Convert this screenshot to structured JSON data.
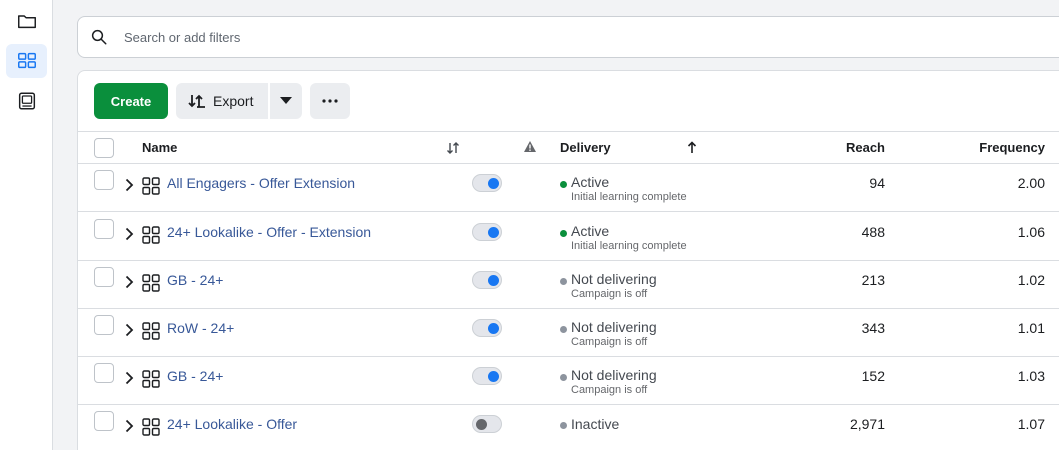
{
  "search": {
    "placeholder": "Search or add filters"
  },
  "toolbar": {
    "create_label": "Create",
    "export_label": "Export"
  },
  "columns": {
    "name": "Name",
    "delivery": "Delivery",
    "reach": "Reach",
    "frequency": "Frequency"
  },
  "colors": {
    "active": "#0a8f3c",
    "inactive": "#8d949e",
    "link": "#385898",
    "toggle_on": "#1877f2"
  },
  "rows": [
    {
      "name": "All Engagers - Offer Extension",
      "on": true,
      "status": "Active",
      "status_type": "active",
      "sub": "Initial learning complete",
      "reach": "94",
      "frequency": "2.00"
    },
    {
      "name": "24+ Lookalike - Offer - Extension",
      "on": true,
      "status": "Active",
      "status_type": "active",
      "sub": "Initial learning complete",
      "reach": "488",
      "frequency": "1.06"
    },
    {
      "name": "GB - 24+",
      "on": true,
      "status": "Not delivering",
      "status_type": "inactive",
      "sub": "Campaign is off",
      "reach": "213",
      "frequency": "1.02"
    },
    {
      "name": "RoW - 24+",
      "on": true,
      "status": "Not delivering",
      "status_type": "inactive",
      "sub": "Campaign is off",
      "reach": "343",
      "frequency": "1.01"
    },
    {
      "name": "GB - 24+",
      "on": true,
      "status": "Not delivering",
      "status_type": "inactive",
      "sub": "Campaign is off",
      "reach": "152",
      "frequency": "1.03"
    },
    {
      "name": "24+ Lookalike - Offer",
      "on": false,
      "status": "Inactive",
      "status_type": "inactive",
      "sub": "",
      "reach": "2,971",
      "frequency": "1.07"
    }
  ]
}
